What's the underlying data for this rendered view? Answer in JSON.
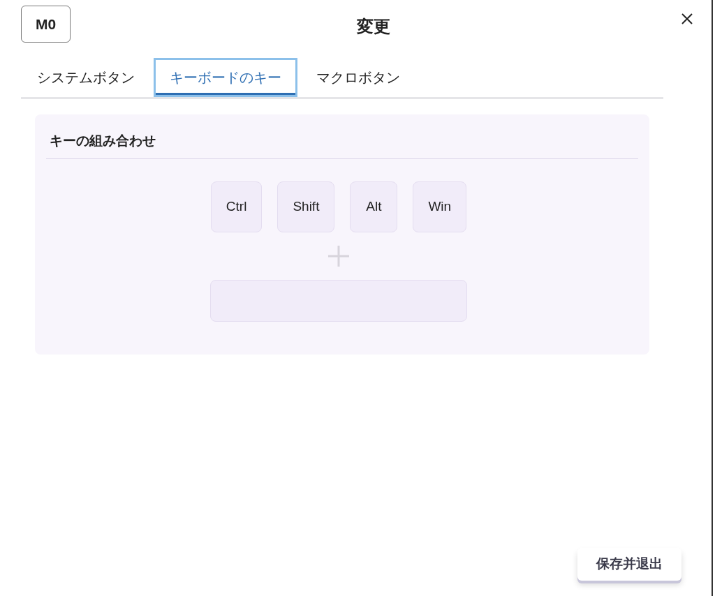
{
  "badge": "M0",
  "title": "変更",
  "tabs": [
    {
      "label": "システムボタン",
      "selected": false
    },
    {
      "label": "キーボードのキー",
      "selected": true
    },
    {
      "label": "マクロボタン",
      "selected": false
    }
  ],
  "panel": {
    "heading": "キーの組み合わせ",
    "modifiers": [
      "Ctrl",
      "Shift",
      "Alt",
      "Win"
    ]
  },
  "save_button": "保存并退出"
}
